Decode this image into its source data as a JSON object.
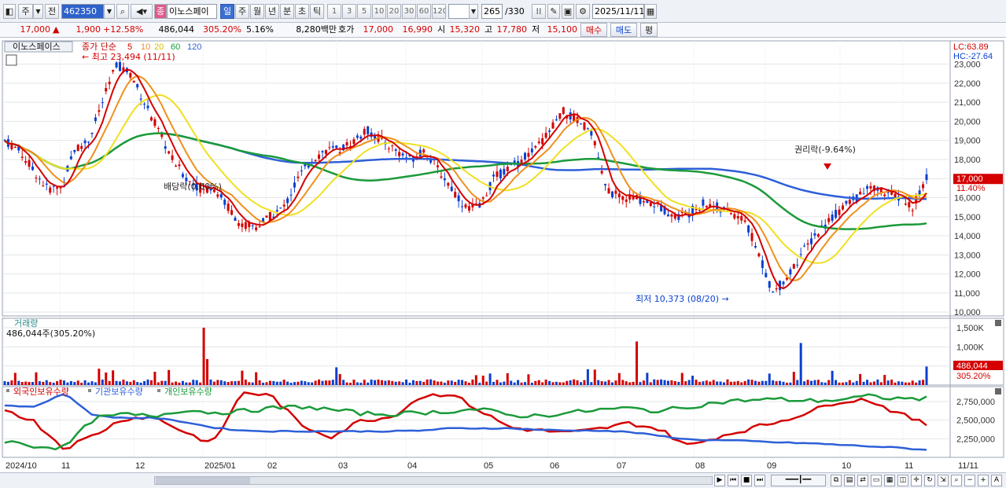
{
  "toolbar": {
    "period": "주",
    "prev": "전",
    "code": "462350",
    "stock_name": "이노스페이",
    "badge": "종",
    "periods": [
      "일",
      "주",
      "월",
      "년",
      "분",
      "초",
      "틱"
    ],
    "active_period": "일",
    "minutes": [
      "1",
      "3",
      "5",
      "10",
      "20",
      "30",
      "60",
      "120"
    ],
    "count": "265",
    "total": "/330",
    "date": "2025/11/11"
  },
  "quote": {
    "price": "17,000",
    "arrow": "▲",
    "change": "1,900",
    "change_pct": "+12.58%",
    "volume": "486,044",
    "vol_ratio": "305.20%",
    "turnover": "5.16%",
    "amount": "8,280백만",
    "ask_label": "호가",
    "ask": "17,000",
    "bid": "16,990",
    "open_label": "시",
    "open": "15,320",
    "high_label": "고",
    "high": "17,780",
    "low_label": "저",
    "low": "15,100",
    "buy": "매수",
    "sell": "매도",
    "avg": "평"
  },
  "price_panel": {
    "title": "이노스페이스",
    "ma_label": "종가 단순",
    "ma_periods": [
      "5",
      "10",
      "20",
      "60",
      "120"
    ],
    "lc": "LC:63.89",
    "hc": "HC:-27.64",
    "annotations": {
      "high": "최고 23,494 (11/11)",
      "low": "최저 10,373 (08/20)",
      "dividend": "배당락(0.00%)",
      "rights": "권리락(-9.64%)"
    },
    "price_tag": "17,000",
    "pct_tag": "11.40%",
    "y_ticks": [
      "23,000",
      "22,000",
      "21,000",
      "20,000",
      "19,000",
      "18,000",
      "17,000",
      "16,000",
      "15,000",
      "14,000",
      "13,000",
      "12,000",
      "11,000",
      "10,000"
    ]
  },
  "volume_panel": {
    "title": "거래량",
    "value": "486,044주(305.20%)",
    "y_ticks": [
      "1,500K",
      "1,000K",
      "500K"
    ],
    "tag": "486,044",
    "tag2": "305.20%"
  },
  "holding_panel": {
    "series": [
      "외국인보유수량",
      "기관보유수량",
      "개인보유수량"
    ],
    "y_ticks": [
      "2,750,000",
      "2,500,000",
      "2,250,000"
    ]
  },
  "x_axis": [
    "2024/10",
    "11",
    "12",
    "2025/01",
    "02",
    "03",
    "04",
    "05",
    "06",
    "07",
    "08",
    "09",
    "10",
    "11"
  ],
  "x_end": "11/11",
  "colors": {
    "up": "#d40000",
    "down": "#0a3fd0",
    "ma5": "#d40000",
    "ma10": "#f0901c",
    "ma20": "#f0e020",
    "ma60": "#1a9a3a",
    "ma120": "#2d5fd8"
  },
  "chart_data": {
    "type": "line",
    "x_range": [
      "2024/10",
      "2025/11/11"
    ],
    "ohlc_path": [
      19000,
      18500,
      17500,
      16500,
      16500,
      18500,
      19000,
      21000,
      23000,
      22500,
      21000,
      19500,
      18000,
      17000,
      16500,
      16500,
      15500,
      14500,
      14500,
      15000,
      15500,
      17000,
      18000,
      18500,
      18500,
      19000,
      19500,
      19000,
      18500,
      18000,
      18500,
      17500,
      16500,
      15500,
      15500,
      17000,
      17500,
      18000,
      18500,
      19500,
      20500,
      20000,
      19500,
      16500,
      16000,
      16000,
      15800,
      15500,
      15000,
      15200,
      15700,
      15500,
      15200,
      14800,
      13000,
      11000,
      11800,
      13000,
      14000,
      14800,
      15500,
      16000,
      16500,
      16300,
      16000,
      15500,
      17000
    ],
    "y_range": [
      9800,
      23600
    ],
    "volume_max": 1500000,
    "holding_range": [
      2000000,
      2950000
    ]
  }
}
